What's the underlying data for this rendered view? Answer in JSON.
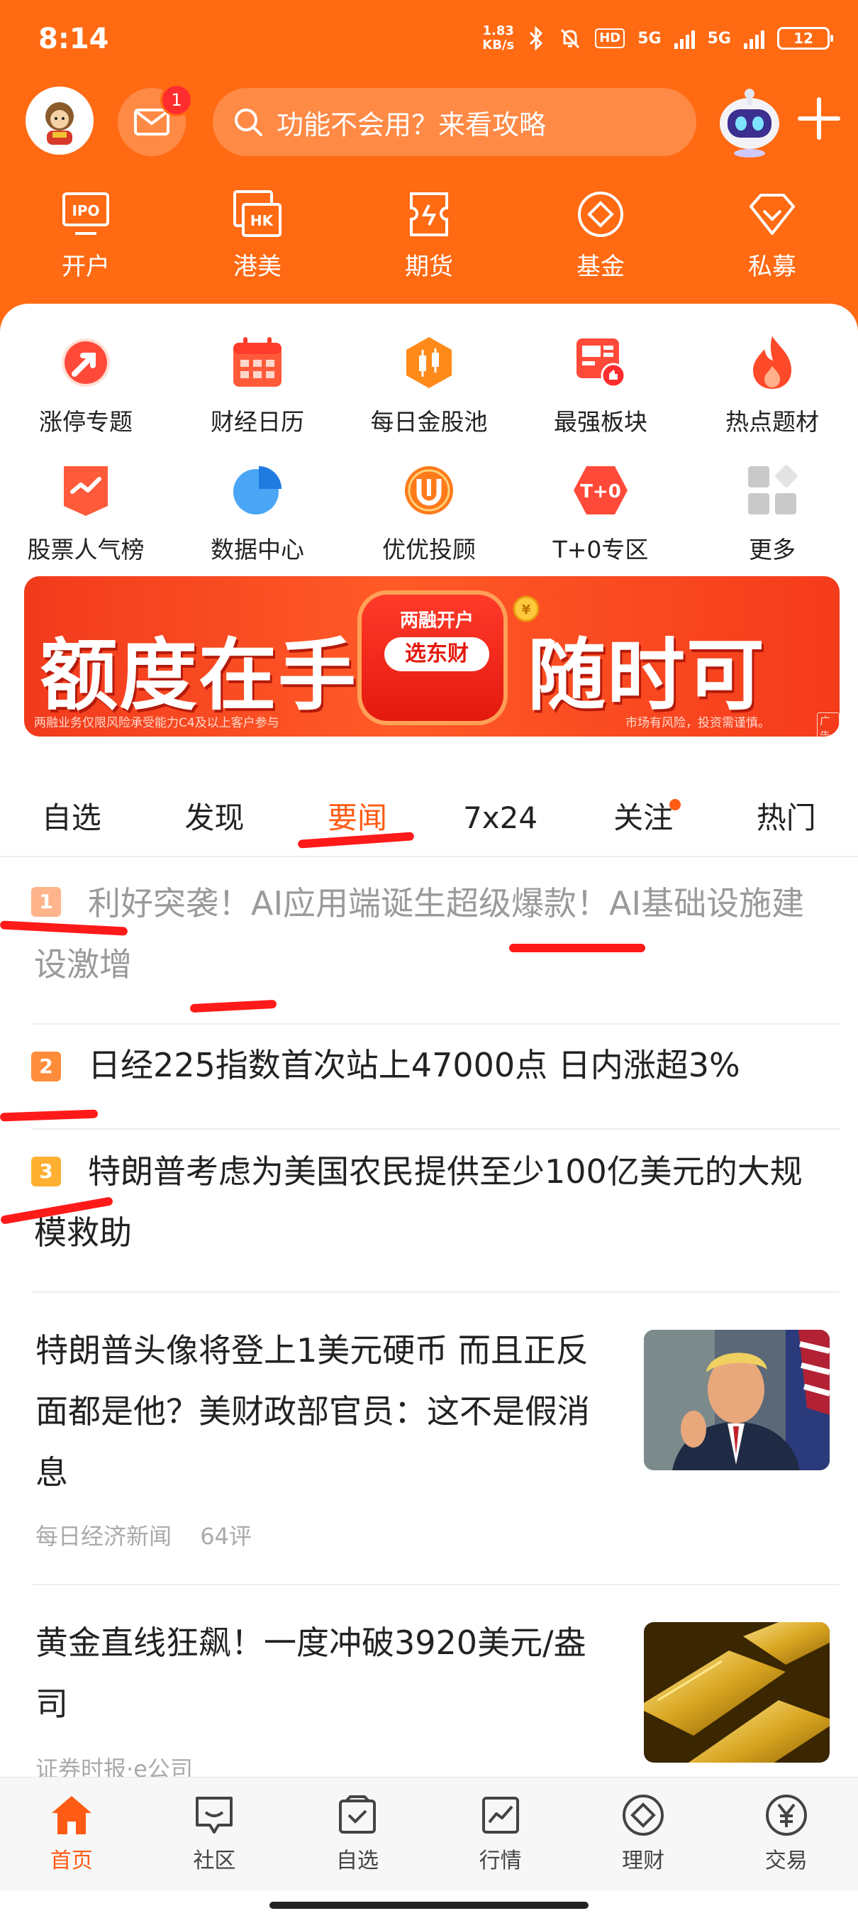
{
  "status": {
    "time": "8:14",
    "netspeed_value": "1.83",
    "netspeed_unit": "KB/s",
    "hd_label": "HD",
    "sig1_label": "5G",
    "sig2_label": "5G",
    "battery": "12"
  },
  "top": {
    "mail_badge": "1",
    "search_placeholder": "功能不会用？来看攻略"
  },
  "nav": {
    "items": [
      {
        "label": "开户",
        "icon": "ipo-account-icon"
      },
      {
        "label": "港美",
        "icon": "hk-us-icon"
      },
      {
        "label": "期货",
        "icon": "futures-icon"
      },
      {
        "label": "基金",
        "icon": "fund-icon"
      },
      {
        "label": "私募",
        "icon": "private-fund-icon"
      }
    ]
  },
  "grid": {
    "items": [
      {
        "label": "涨停专题"
      },
      {
        "label": "财经日历"
      },
      {
        "label": "每日金股池"
      },
      {
        "label": "最强板块"
      },
      {
        "label": "热点题材"
      },
      {
        "label": "股票人气榜"
      },
      {
        "label": "数据中心"
      },
      {
        "label": "优优投顾"
      },
      {
        "label": "T+0专区"
      },
      {
        "label": "更多"
      }
    ]
  },
  "banner": {
    "left_text": "额度在手",
    "right_text": "随时可用",
    "badge_top": "两融开户",
    "badge_main": "选东财",
    "footnote": "两融业务仅限风险承受能力C4及以上客户参与",
    "risk_note": "市场有风险，投资需谨慎。",
    "ad_tag": "广告"
  },
  "tabs": [
    "自选",
    "发现",
    "要闻",
    "7x24",
    "关注",
    "热门"
  ],
  "active_tab": "要闻",
  "ranked_news": [
    {
      "rank": "1",
      "title": "利好突袭！AI应用端诞生超级爆款！AI基础设施建设激增",
      "read": true
    },
    {
      "rank": "2",
      "title": "日经225指数首次站上47000点 日内涨超3%",
      "read": false
    },
    {
      "rank": "3",
      "title": "特朗普考虑为美国农民提供至少100亿美元的大规模救助",
      "read": false
    }
  ],
  "articles": [
    {
      "title": "特朗普头像将登上1美元硬币 而且正反面都是他？美财政部官员：这不是假消息",
      "source": "每日经济新闻",
      "comments": "64评"
    },
    {
      "title": "黄金直线狂飙！一度冲破3920美元/盎司",
      "source": "证券时报·e公司",
      "comments": ""
    }
  ],
  "bottom_nav": [
    "首页",
    "社区",
    "自选",
    "行情",
    "理财",
    "交易"
  ],
  "colors": {
    "brand": "#ff6a13",
    "accent": "#ff5b14",
    "rank1": "#ff7a3c",
    "rank2": "#ff8c3a",
    "rank3": "#ffb030",
    "scribble": "#ff1a1a"
  }
}
